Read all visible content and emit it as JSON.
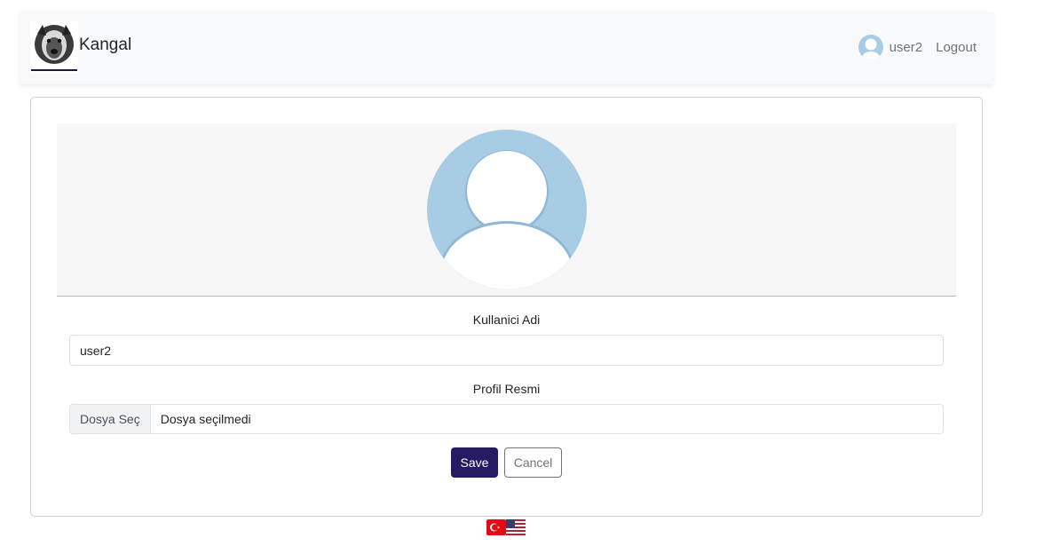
{
  "navbar": {
    "brand_name": "Kangal",
    "username": "user2",
    "logout_label": "Logout"
  },
  "profile": {
    "username_label": "Kullanici Adi",
    "username_value": "user2",
    "image_label": "Profil Resmi",
    "file_button_label": "Dosya Seç",
    "file_status": "Dosya seçilmedi"
  },
  "actions": {
    "save_label": "Save",
    "cancel_label": "Cancel"
  },
  "languages": [
    {
      "name": "turkish-flag-icon"
    },
    {
      "name": "us-flag-icon"
    }
  ],
  "colors": {
    "primary": "#251a63",
    "avatar_bg": "#a8cce4"
  }
}
